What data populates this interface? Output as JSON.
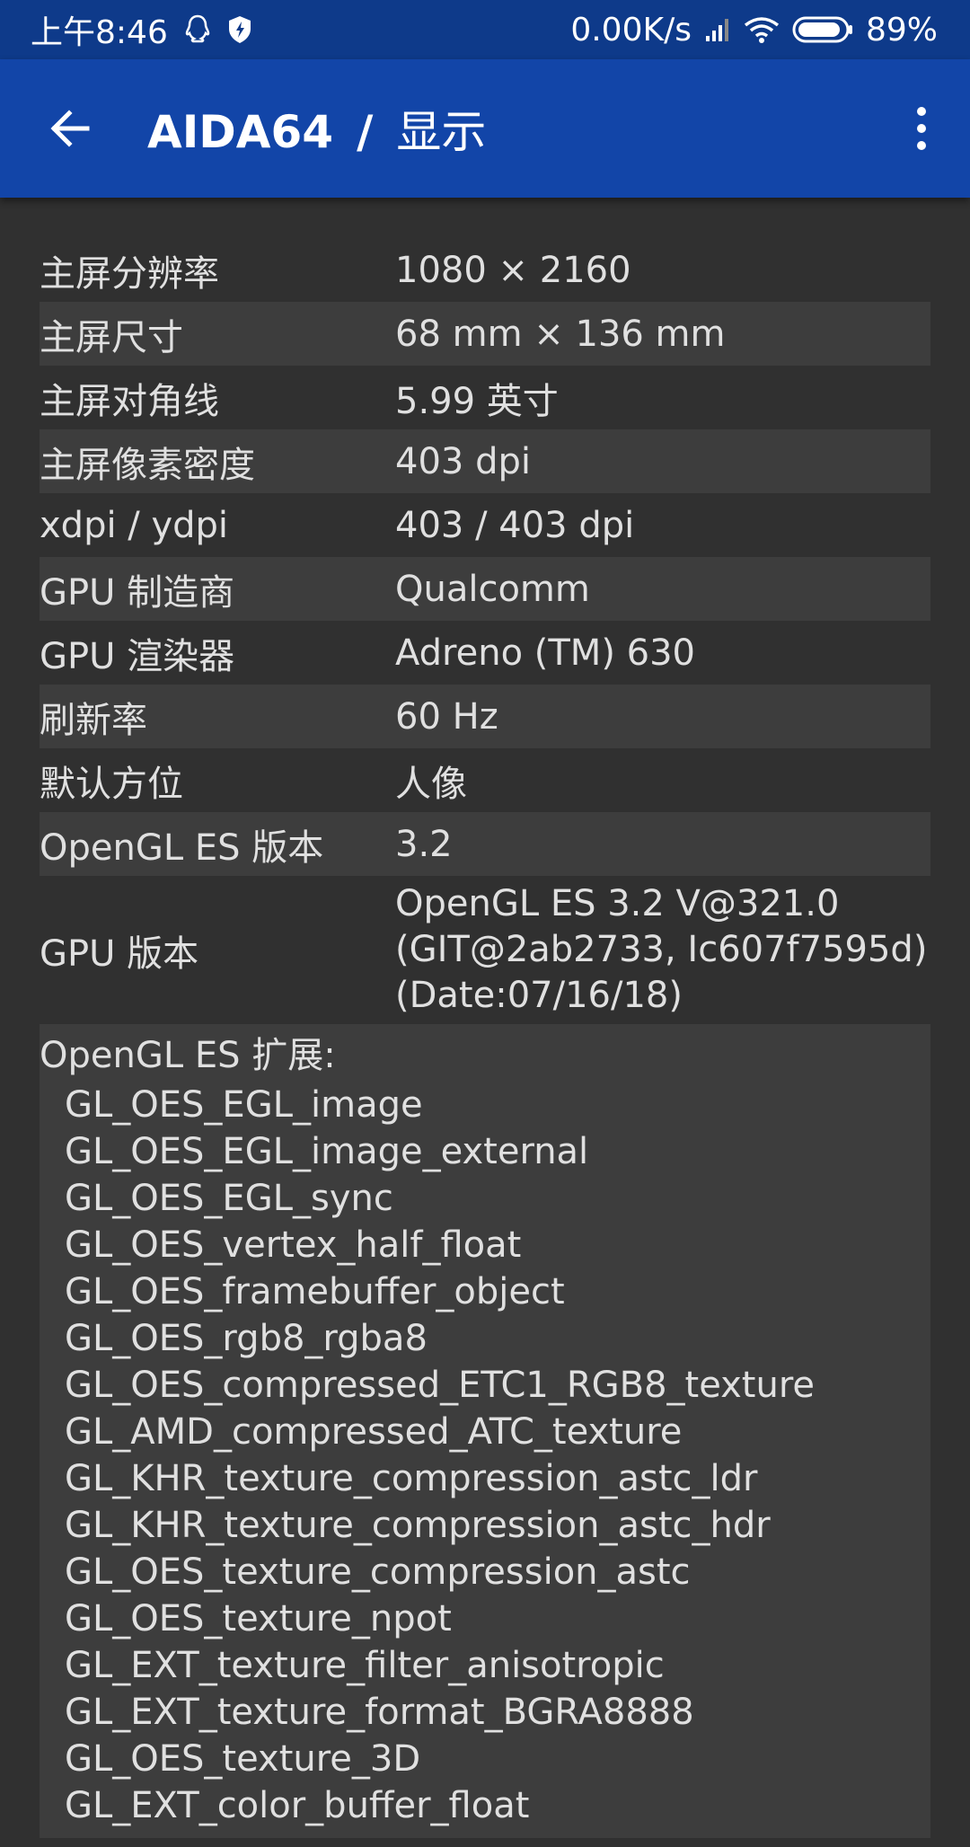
{
  "status_bar": {
    "time": "上午8:46",
    "network_speed": "0.00K/s",
    "battery": "89%"
  },
  "toolbar": {
    "app_name": "AIDA64",
    "separator": "/",
    "section": "显示"
  },
  "rows": [
    {
      "label": "主屏分辨率",
      "value": "1080 × 2160"
    },
    {
      "label": "主屏尺寸",
      "value": "68 mm × 136 mm"
    },
    {
      "label": "主屏对角线",
      "value": "5.99 英寸"
    },
    {
      "label": "主屏像素密度",
      "value": "403 dpi"
    },
    {
      "label": "xdpi / ydpi",
      "value": "403 / 403 dpi"
    },
    {
      "label": "GPU 制造商",
      "value": "Qualcomm"
    },
    {
      "label": "GPU 渲染器",
      "value": "Adreno (TM) 630"
    },
    {
      "label": "刷新率",
      "value": "60 Hz"
    },
    {
      "label": "默认方位",
      "value": "人像"
    },
    {
      "label": "OpenGL ES 版本",
      "value": "3.2"
    }
  ],
  "gpu_version": {
    "label": "GPU 版本",
    "lines": [
      "OpenGL ES 3.2 V@321.0",
      "(GIT@2ab2733, Ic607f7595d)",
      "(Date:07/16/18)"
    ]
  },
  "extensions": {
    "title": "OpenGL ES 扩展:",
    "items": [
      "GL_OES_EGL_image",
      "GL_OES_EGL_image_external",
      "GL_OES_EGL_sync",
      "GL_OES_vertex_half_float",
      "GL_OES_framebuffer_object",
      "GL_OES_rgb8_rgba8",
      "GL_OES_compressed_ETC1_RGB8_texture",
      "GL_AMD_compressed_ATC_texture",
      "GL_KHR_texture_compression_astc_ldr",
      "GL_KHR_texture_compression_astc_hdr",
      "GL_OES_texture_compression_astc",
      "GL_OES_texture_npot",
      "GL_EXT_texture_filter_anisotropic",
      "GL_EXT_texture_format_BGRA8888",
      "GL_OES_texture_3D",
      "GL_EXT_color_buffer_float"
    ]
  }
}
